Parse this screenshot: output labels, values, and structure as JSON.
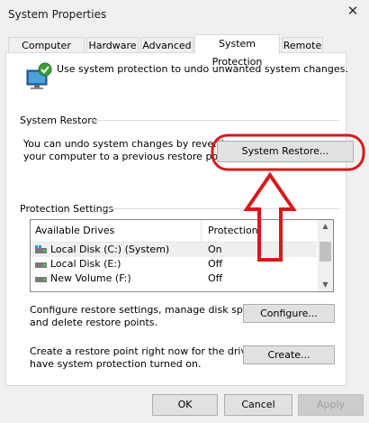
{
  "window": {
    "title": "System Properties",
    "close_glyph": "✕"
  },
  "tabs": [
    {
      "label": "Computer Name",
      "active": false
    },
    {
      "label": "Hardware",
      "active": false
    },
    {
      "label": "Advanced",
      "active": false
    },
    {
      "label": "System Protection",
      "active": true
    },
    {
      "label": "Remote",
      "active": false
    }
  ],
  "intro": {
    "text": "Use system protection to undo unwanted system changes.",
    "icon": "system-protection-icon"
  },
  "system_restore": {
    "group_label": "System Restore",
    "description_line1": "You can undo system changes by reverting",
    "description_line2": "your computer to a previous restore point.",
    "button_label": "System Restore..."
  },
  "annotations": {
    "highlight_color": "#d7191c",
    "arrow_color": "#d7191c"
  },
  "protection": {
    "group_label": "Protection Settings",
    "columns": [
      "Available Drives",
      "Protection"
    ],
    "drives": [
      {
        "name": "Local Disk (C:) (System)",
        "protection": "On",
        "icon": "system-drive-icon"
      },
      {
        "name": "Local Disk (E:)",
        "protection": "Off",
        "icon": "drive-icon"
      },
      {
        "name": "New Volume (F:)",
        "protection": "Off",
        "icon": "drive-icon"
      }
    ],
    "configure_line1": "Configure restore settings, manage disk space,",
    "configure_line2": "and delete restore points.",
    "configure_button": "Configure...",
    "create_line1": "Create a restore point right now for the drives that",
    "create_line2": "have system protection turned on.",
    "create_button": "Create..."
  },
  "footer": {
    "ok": "OK",
    "cancel": "Cancel",
    "apply": "Apply"
  }
}
